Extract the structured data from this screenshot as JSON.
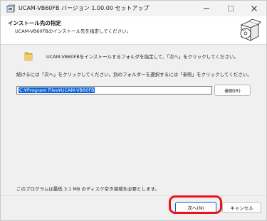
{
  "window": {
    "title": "UCAM-VB60FB バージョン 1.00.00 セットアップ",
    "icons": {
      "app": "setup-box-icon",
      "minimize": "minimize-icon",
      "maximize": "maximize-icon",
      "close": "close-icon"
    }
  },
  "header": {
    "title": "インストール先の指定",
    "subtitle": "UCAM-VB60FBのインストール先を指定してください。",
    "logo": "install-disc-box-icon"
  },
  "body": {
    "folder_icon": "folder-icon",
    "message1": "UCAM-VB60FBをインストールするフォルダを指定して、「次へ」をクリックしてください。",
    "message2": "続けるには「次へ」をクリックしてください。別のフォルダーを選択するには「参照」をクリックしてください。",
    "install_path": "C:¥Program Files¥UCAM-VB60FB",
    "browse_label": "参照(R)",
    "space_note": "このプログラムは最低 3.1 MB のディスク空き領域を必要とします。"
  },
  "footer": {
    "next_label": "次へ(N)",
    "cancel_label": "キャンセル"
  },
  "colors": {
    "highlight": "#e8161b",
    "selection": "#0a64d7",
    "default_button_border": "#0b5fd0"
  }
}
